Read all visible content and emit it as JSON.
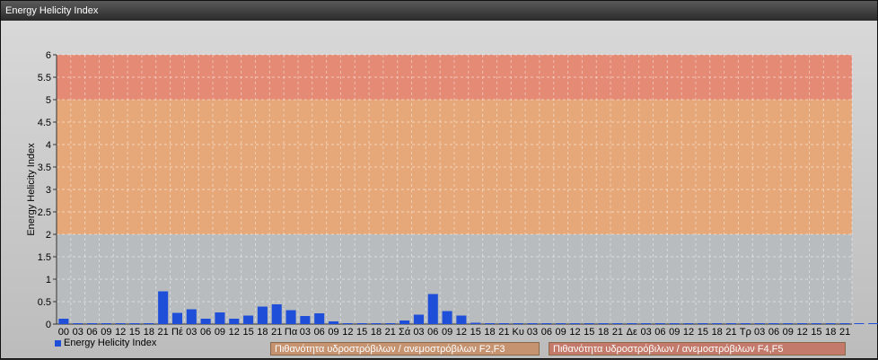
{
  "window": {
    "title": "Energy Helicity Index"
  },
  "chart_data": {
    "type": "bar",
    "title": "",
    "ylabel": "Energy Helicity Index",
    "xlabel": "",
    "ylim": [
      0,
      6
    ],
    "yticks": [
      "0",
      "0.5",
      "1",
      "1.5",
      "2",
      "2.5",
      "3",
      "3.5",
      "4",
      "4.5",
      "5",
      "5.5",
      "6"
    ],
    "categories": [
      "00",
      "03",
      "06",
      "09",
      "12",
      "15",
      "18",
      "21",
      "Πέ",
      "03",
      "06",
      "09",
      "12",
      "15",
      "18",
      "21",
      "Πα",
      "03",
      "06",
      "09",
      "12",
      "15",
      "18",
      "21",
      "Σά",
      "03",
      "06",
      "09",
      "12",
      "15",
      "18",
      "21",
      "Κυ",
      "03",
      "06",
      "09",
      "12",
      "15",
      "18",
      "21",
      "Δε",
      "03",
      "06",
      "09",
      "12",
      "15",
      "18",
      "21",
      "Τρ",
      "03",
      "06",
      "09",
      "12",
      "15",
      "18",
      "21"
    ],
    "series": [
      {
        "name": "Energy Helicity Index",
        "color": "#1f4fd8",
        "values": [
          0.12,
          0.02,
          0.02,
          0.01,
          0.01,
          0.01,
          0.02,
          0.73,
          0.25,
          0.33,
          0.12,
          0.26,
          0.12,
          0.19,
          0.39,
          0.44,
          0.31,
          0.18,
          0.24,
          0.06,
          0.02,
          0.01,
          0.01,
          0.02,
          0.08,
          0.21,
          0.67,
          0.29,
          0.19,
          0.03,
          0.01,
          0.01,
          0.01,
          0.01,
          0.02,
          0.01,
          0.01,
          0.01,
          0.01,
          0.01,
          0.01,
          0.02,
          0.01,
          0.01,
          0.01,
          0.01,
          0.01,
          0.01,
          0.01,
          0.01,
          0.01,
          0.01,
          0.01,
          0.01,
          0.01,
          0.01,
          0.01,
          0.01
        ]
      }
    ],
    "bands": [
      {
        "from": 0,
        "to": 2,
        "color": "#b8bcbf"
      },
      {
        "from": 2,
        "to": 5,
        "color": "#e6a878",
        "label": "Πιθανότητα υδροστρόβιλων / ανεμοστρόβιλων F2,F3"
      },
      {
        "from": 5,
        "to": 6,
        "color": "#e58a74",
        "label": "Πιθανότητα υδροστρόβιλων / ανεμοστρόβιλων F4,F5"
      }
    ],
    "grid": true,
    "legend_position": "bottom-left"
  }
}
